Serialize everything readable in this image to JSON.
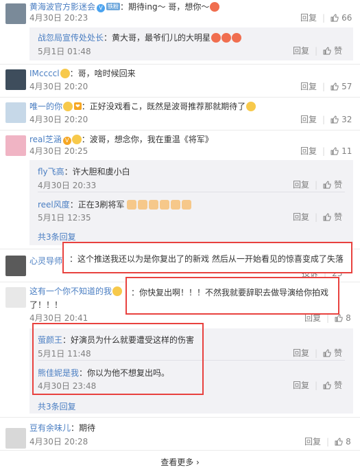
{
  "comments": [
    {
      "name": "黄海波官方影迷会",
      "badge": "铁粉",
      "text": "：期待ing～ 哥，想你～",
      "time": "4月30日 20:23",
      "like": "66"
    },
    {
      "name": "战忽局宣传处处长",
      "text": "：黄大哥，最爷们儿的大明星",
      "time": "5月1日 01:48"
    },
    {
      "name": "IMccccl",
      "text": "：哥，啥时候回来",
      "time": "4月30日 20:20",
      "like": "57"
    },
    {
      "name": "唯一的你",
      "text": "：正好没戏看こ，既然是波哥推荐那就期待了",
      "time": "4月30日 20:20",
      "like": "32"
    },
    {
      "name": "real芝涵",
      "text": "：波哥，想念你，我在重温《将军》",
      "time": "4月30日 20:25",
      "like": "11"
    },
    {
      "name": "fly飞高",
      "text": "：许大胆和虞小白",
      "time": "4月30日 20:33"
    },
    {
      "name": "reel风度",
      "text": "：正在3刷将军",
      "time": "5月1日 12:35"
    },
    {
      "name": "心灵导师",
      "text": "：这个推送我还以为是你复出了的新戏  然后从一开始看见的惊喜变成了失落",
      "like": "23"
    },
    {
      "name": "这有一个你不知道的我",
      "text": "：你快复出啊！！！不然我就要辞职去做导演给你拍戏",
      "text2": "了！！！",
      "time": "4月30日 20:41",
      "like": "8"
    },
    {
      "name": "萤颜王",
      "text": "：好演员为什么就要遭受这样的伤害",
      "time": "5月1日 11:48"
    },
    {
      "name": "熊佳妮是我",
      "text": "：你以为他不想复出吗。",
      "time": "4月30日 23:48"
    },
    {
      "name": "豆有余味儿",
      "text": "：期待",
      "time": "4月30日 20:28",
      "like": "8"
    }
  ],
  "labels": {
    "reply": "回复",
    "like": "赞",
    "report": "投诉",
    "reply3": "共3条回复",
    "seemore": "查看更多 ›"
  }
}
